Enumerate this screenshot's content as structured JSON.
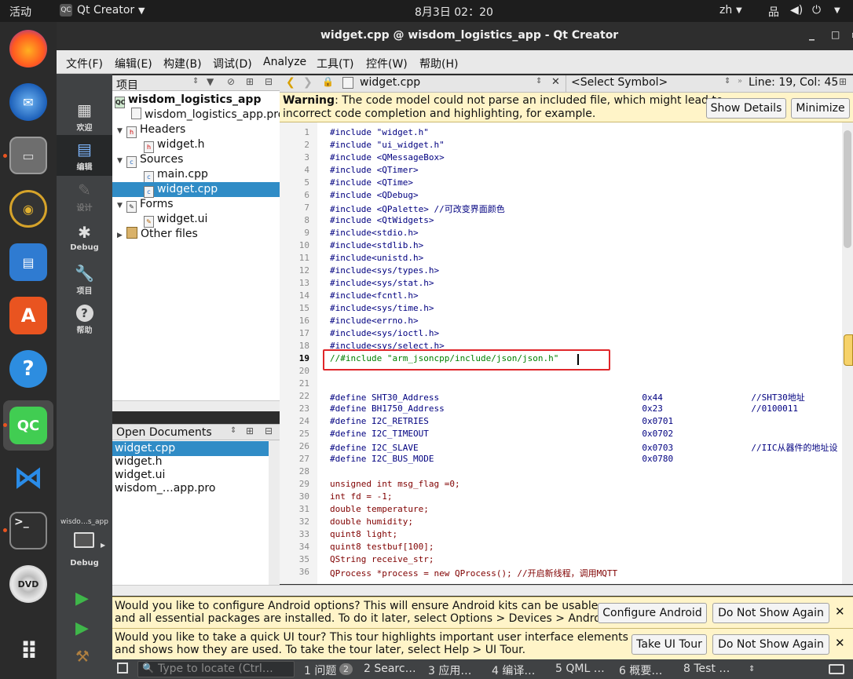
{
  "topbar": {
    "activities": "活动",
    "app_name": "Qt Creator",
    "datetime": "8月3日  02：20",
    "input_method": "zh"
  },
  "window": {
    "title": "widget.cpp @ wisdom_logistics_app - Qt Creator"
  },
  "menu": [
    "文件(F)",
    "编辑(E)",
    "构建(B)",
    "调试(D)",
    "Analyze",
    "工具(T)",
    "控件(W)",
    "帮助(H)"
  ],
  "modes": [
    {
      "label": "欢迎"
    },
    {
      "label": "编辑"
    },
    {
      "label": "设计"
    },
    {
      "label": "Debug"
    },
    {
      "label": "项目"
    },
    {
      "label": "帮助"
    }
  ],
  "kit": {
    "name": "wisdo…s_app",
    "mode": "Debug"
  },
  "project_pane": {
    "title": "项目"
  },
  "tree": {
    "project": "wisdom_logistics_app",
    "pro_file": "wisdom_logistics_app.pro",
    "headers": "Headers",
    "header_widget": "widget.h",
    "sources": "Sources",
    "main": "main.cpp",
    "widget_cpp": "widget.cpp",
    "forms": "Forms",
    "widget_ui": "widget.ui",
    "other": "Other files"
  },
  "open_docs": {
    "title": "Open Documents",
    "items": [
      "widget.cpp",
      "widget.h",
      "widget.ui",
      "wisdom_…app.pro"
    ]
  },
  "editor": {
    "file": "widget.cpp",
    "symbol": "<Select Symbol>",
    "position": "Line: 19, Col: 45"
  },
  "warning": {
    "bold": "Warning",
    "line1": ": The code model could not parse an included file, which might lead to",
    "line2": "incorrect code completion and highlighting, for example.",
    "show_details": "Show Details",
    "minimize": "Minimize"
  },
  "code_lines": [
    "#include \"widget.h\"",
    "#include \"ui_widget.h\"",
    "#include <QMessageBox>",
    "#include <QTimer>",
    "#include <QTime>",
    "#include <QDebug>",
    "#include <QPalette> //可改变界面颜色",
    "#include <QtWidgets>",
    "#include<stdio.h>",
    "#include<stdlib.h>",
    "#include<unistd.h>",
    "#include<sys/types.h>",
    "#include<sys/stat.h>",
    "#include<fcntl.h>",
    "#include<sys/time.h>",
    "#include<errno.h>",
    "#include<sys/ioctl.h>",
    "#include<sys/select.h>",
    "//#include \"arm_jsoncpp/include/json/json.h\"",
    "",
    "",
    "#define SHT30_Address                                       0x44                 //SHT30地址",
    "#define BH1750_Address                                      0x23                 //0100011",
    "#define I2C_RETRIES                                         0x0701",
    "#define I2C_TIMEOUT                                         0x0702",
    "#define I2C_SLAVE                                           0x0703               //IIC从器件的地址设",
    "#define I2C_BUS_MODE                                        0x0780",
    "",
    "unsigned int msg_flag =0;",
    "int fd = -1;",
    "double temperature;",
    "double humidity;",
    "quint8 light;",
    "quint8 testbuf[100];",
    "QString receive_str;",
    "QProcess *process = new QProcess(); //开启新线程，调用MQTT"
  ],
  "notifications": [
    {
      "line1": "Would you like to configure Android options? This will ensure Android kits can be usable",
      "line2": "and all essential packages are installed. To do it later, select Options > Devices > Android.",
      "btn1": "Configure Android",
      "btn2": "Do Not Show Again"
    },
    {
      "line1": "Would you like to take a quick UI tour? This tour highlights important user interface elements",
      "line2": "and shows how they are used. To take the tour later, select Help > UI Tour.",
      "btn1": "Take UI Tour",
      "btn2": "Do Not Show Again"
    }
  ],
  "statusbar": {
    "locate_placeholder": "Type to locate (Ctrl…",
    "tabs": [
      "1 问题",
      "2 Searc…",
      "3 应用…",
      "4 编译…",
      "5 QML …",
      "6 概要…",
      "8 Test …"
    ],
    "issues_count": "2"
  },
  "colors": {
    "accent": "#308cc6",
    "highlight_box": "#e0262a",
    "warning_bg": "#fff4c8"
  }
}
